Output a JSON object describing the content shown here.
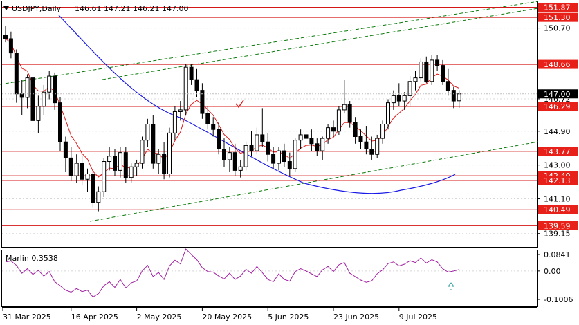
{
  "header": {
    "symbol": "USDJPY,Daily",
    "ohlc": "146.61 147.21 146.21 147.00"
  },
  "chart_data": {
    "type": "candlestick",
    "ylim": [
      138.4,
      152.2
    ],
    "price_ticks": [
      {
        "value": 150.7,
        "label": "150.70"
      },
      {
        "value": 146.72,
        "label": "146.72"
      },
      {
        "value": 144.9,
        "label": "144.90"
      },
      {
        "value": 143.0,
        "label": "143.00"
      },
      {
        "value": 141.1,
        "label": "141.10"
      },
      {
        "value": 139.15,
        "label": "139.15"
      }
    ],
    "levels": [
      {
        "value": 151.87,
        "label": "151.87"
      },
      {
        "value": 151.3,
        "label": "151.30"
      },
      {
        "value": 148.66,
        "label": "148.66"
      },
      {
        "value": 146.29,
        "label": "146.29"
      },
      {
        "value": 143.77,
        "label": "143.77"
      },
      {
        "value": 142.4,
        "label": "142.40"
      },
      {
        "value": 142.13,
        "label": "142.13"
      },
      {
        "value": 140.49,
        "label": "140.49"
      },
      {
        "value": 139.59,
        "label": "139.59"
      }
    ],
    "current_price": {
      "value": 147.0,
      "label": "147.00"
    },
    "x_labels": [
      "31 Mar 2025",
      "16 Apr 2025",
      "2 May 2025",
      "20 May 2025",
      "5 Jun 2025",
      "23 Jun 2025",
      "9 Jul 2025"
    ],
    "x_label_index": [
      0,
      12,
      24,
      36,
      48,
      60,
      72
    ],
    "candles": [
      [
        150.3,
        150.8,
        149.9,
        150.1
      ],
      [
        150.1,
        150.5,
        149.0,
        149.3
      ],
      [
        149.3,
        149.5,
        146.5,
        147.0
      ],
      [
        147.0,
        147.8,
        145.8,
        146.8
      ],
      [
        146.8,
        148.1,
        146.2,
        147.9
      ],
      [
        147.9,
        148.3,
        145.0,
        145.5
      ],
      [
        145.5,
        146.9,
        144.8,
        146.3
      ],
      [
        146.3,
        147.5,
        145.8,
        147.1
      ],
      [
        147.1,
        148.3,
        146.7,
        148.0
      ],
      [
        148.0,
        148.2,
        146.1,
        146.5
      ],
      [
        146.5,
        146.8,
        143.8,
        144.3
      ],
      [
        144.3,
        144.6,
        142.6,
        143.4
      ],
      [
        143.4,
        144.0,
        142.1,
        142.4
      ],
      [
        142.4,
        143.6,
        142.0,
        143.1
      ],
      [
        143.1,
        143.5,
        141.9,
        142.2
      ],
      [
        142.2,
        142.8,
        141.5,
        142.5
      ],
      [
        142.5,
        142.7,
        140.6,
        140.9
      ],
      [
        140.9,
        141.8,
        140.4,
        141.5
      ],
      [
        141.5,
        143.4,
        141.2,
        143.2
      ],
      [
        143.2,
        144.0,
        142.7,
        143.5
      ],
      [
        143.5,
        143.9,
        142.4,
        142.7
      ],
      [
        142.7,
        144.0,
        142.3,
        143.7
      ],
      [
        143.7,
        144.0,
        142.0,
        142.3
      ],
      [
        142.3,
        143.1,
        142.0,
        142.9
      ],
      [
        142.9,
        143.3,
        142.4,
        143.1
      ],
      [
        143.1,
        144.6,
        142.8,
        144.4
      ],
      [
        144.4,
        145.6,
        144.0,
        145.3
      ],
      [
        145.3,
        145.8,
        142.8,
        143.1
      ],
      [
        143.1,
        143.9,
        142.5,
        143.6
      ],
      [
        143.6,
        144.3,
        142.2,
        142.5
      ],
      [
        142.5,
        145.1,
        142.3,
        144.8
      ],
      [
        144.8,
        146.3,
        144.4,
        146.0
      ],
      [
        146.0,
        146.6,
        145.5,
        146.1
      ],
      [
        146.1,
        148.7,
        145.8,
        148.5
      ],
      [
        148.5,
        148.7,
        147.5,
        147.8
      ],
      [
        147.8,
        148.4,
        146.8,
        147.2
      ],
      [
        147.2,
        147.6,
        145.6,
        145.9
      ],
      [
        145.9,
        146.3,
        145.0,
        145.3
      ],
      [
        145.3,
        145.7,
        144.6,
        145.0
      ],
      [
        145.0,
        145.4,
        143.6,
        143.9
      ],
      [
        143.9,
        144.5,
        142.9,
        143.3
      ],
      [
        143.3,
        144.0,
        142.6,
        143.7
      ],
      [
        143.7,
        144.2,
        142.4,
        142.7
      ],
      [
        142.7,
        143.3,
        142.3,
        142.9
      ],
      [
        142.9,
        144.3,
        142.7,
        144.1
      ],
      [
        144.1,
        144.9,
        143.5,
        143.8
      ],
      [
        143.8,
        145.1,
        143.6,
        144.7
      ],
      [
        144.7,
        146.2,
        144.0,
        144.3
      ],
      [
        144.3,
        144.8,
        143.2,
        143.6
      ],
      [
        143.6,
        144.0,
        142.8,
        143.1
      ],
      [
        143.1,
        144.0,
        142.7,
        143.8
      ],
      [
        143.8,
        144.2,
        142.9,
        143.2
      ],
      [
        143.2,
        143.7,
        142.4,
        142.8
      ],
      [
        142.8,
        144.5,
        142.6,
        144.4
      ],
      [
        144.4,
        145.0,
        143.9,
        144.7
      ],
      [
        144.7,
        145.3,
        144.1,
        144.5
      ],
      [
        144.5,
        145.0,
        143.8,
        144.2
      ],
      [
        144.2,
        144.5,
        143.5,
        143.8
      ],
      [
        143.8,
        144.6,
        143.3,
        144.5
      ],
      [
        144.5,
        145.3,
        144.2,
        145.1
      ],
      [
        145.1,
        145.5,
        144.6,
        144.9
      ],
      [
        144.9,
        146.3,
        144.7,
        146.1
      ],
      [
        146.1,
        147.8,
        145.9,
        146.4
      ],
      [
        146.4,
        146.6,
        145.1,
        145.4
      ],
      [
        145.4,
        145.7,
        144.2,
        144.6
      ],
      [
        144.6,
        145.0,
        143.9,
        144.3
      ],
      [
        144.3,
        145.2,
        143.6,
        143.9
      ],
      [
        143.9,
        144.6,
        143.3,
        143.6
      ],
      [
        143.6,
        144.7,
        143.4,
        144.5
      ],
      [
        144.5,
        145.5,
        144.2,
        145.3
      ],
      [
        145.3,
        146.7,
        145.0,
        146.5
      ],
      [
        146.5,
        147.2,
        146.1,
        146.9
      ],
      [
        146.9,
        147.6,
        146.3,
        146.6
      ],
      [
        146.6,
        147.1,
        146.1,
        146.9
      ],
      [
        146.9,
        148.0,
        146.3,
        147.7
      ],
      [
        147.7,
        148.3,
        147.2,
        147.9
      ],
      [
        147.9,
        149.0,
        147.7,
        148.8
      ],
      [
        148.8,
        149.1,
        147.6,
        147.7
      ],
      [
        147.7,
        149.2,
        147.5,
        148.9
      ],
      [
        148.9,
        149.2,
        148.3,
        148.6
      ],
      [
        148.6,
        148.9,
        147.5,
        147.7
      ],
      [
        147.7,
        148.4,
        146.9,
        147.2
      ],
      [
        147.2,
        147.4,
        146.2,
        146.6
      ],
      [
        146.61,
        147.21,
        146.21,
        147.0
      ]
    ],
    "oscillator": {
      "label": "Marlin 0.3538",
      "ylim": [
        -0.125,
        0.073
      ],
      "ticks": [
        {
          "value": 0.0841,
          "label": "0.0841"
        },
        {
          "value": 0.0,
          "label": "0.00"
        },
        {
          "value": -0.1006,
          "label": "-0.1006"
        }
      ],
      "values": [
        0.032,
        0.035,
        0.02,
        -0.008,
        0.008,
        -0.012,
        0.002,
        -0.018,
        -0.002,
        -0.038,
        -0.052,
        -0.068,
        -0.075,
        -0.062,
        -0.073,
        -0.068,
        -0.092,
        -0.08,
        -0.052,
        -0.038,
        -0.058,
        -0.03,
        -0.06,
        -0.042,
        -0.035,
        0.0,
        0.02,
        -0.02,
        -0.005,
        -0.03,
        0.018,
        0.038,
        0.025,
        0.078,
        0.058,
        0.04,
        0.012,
        -0.002,
        -0.004,
        -0.018,
        -0.028,
        -0.008,
        -0.03,
        -0.018,
        0.006,
        -0.008,
        0.016,
        -0.006,
        -0.03,
        -0.038,
        -0.01,
        -0.03,
        -0.036,
        -0.002,
        0.008,
        0.0,
        -0.01,
        -0.02,
        0.004,
        0.016,
        -0.002,
        0.022,
        0.03,
        -0.008,
        -0.02,
        -0.032,
        -0.04,
        -0.035,
        -0.01,
        0.004,
        0.026,
        0.032,
        0.018,
        0.024,
        0.036,
        0.03,
        0.046,
        0.028,
        0.04,
        0.032,
        0.008,
        -0.004,
        0.0,
        0.005
      ]
    }
  }
}
